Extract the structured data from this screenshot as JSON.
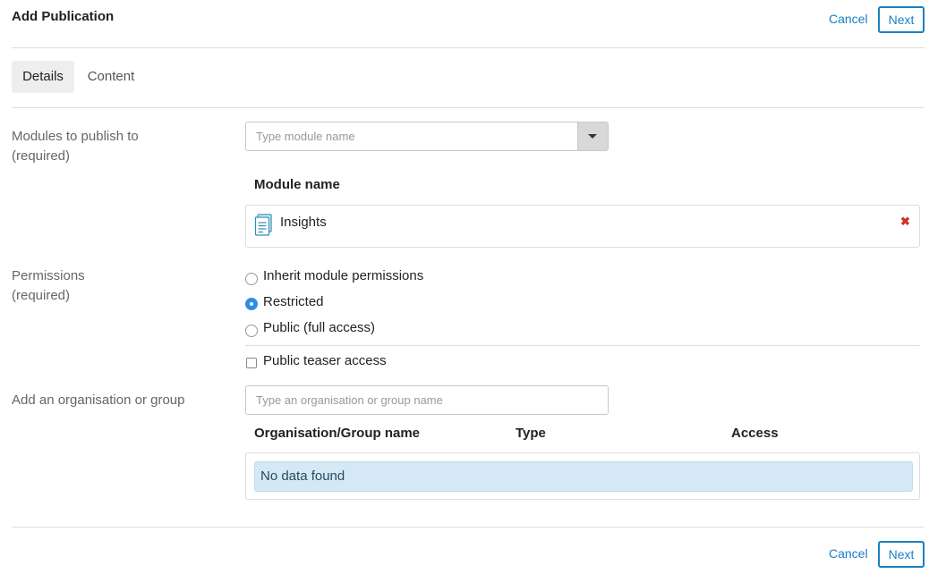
{
  "header": {
    "title": "Add Publication",
    "cancel_label": "Cancel",
    "next_label": "Next"
  },
  "tabs": [
    {
      "label": "Details",
      "active": true
    },
    {
      "label": "Content",
      "active": false
    }
  ],
  "modules": {
    "label_line1": "Modules to publish to",
    "label_line2": "(required)",
    "input_placeholder": "Type module name",
    "column_header": "Module name",
    "items": [
      {
        "name": "Insights",
        "icon": "document-icon",
        "remove_icon": "remove-icon"
      }
    ]
  },
  "permissions": {
    "label_line1": "Permissions",
    "label_line2": "(required)",
    "options": [
      {
        "label": "Inherit module permissions",
        "selected": false
      },
      {
        "label": "Restricted",
        "selected": true
      },
      {
        "label": "Public (full access)",
        "selected": false
      }
    ],
    "teaser_label": "Public teaser access",
    "teaser_checked": false
  },
  "organisation": {
    "label": "Add an organisation or group",
    "input_placeholder": "Type an organisation or group name",
    "columns": [
      "Organisation/Group name",
      "Type",
      "Access"
    ],
    "empty_message": "No data found"
  },
  "footer": {
    "cancel_label": "Cancel",
    "next_label": "Next"
  },
  "colors": {
    "accent": "#1a7fc1",
    "radio_selected": "#2e8de6",
    "remove": "#d03030",
    "empty_bg": "#d4e9f5"
  }
}
